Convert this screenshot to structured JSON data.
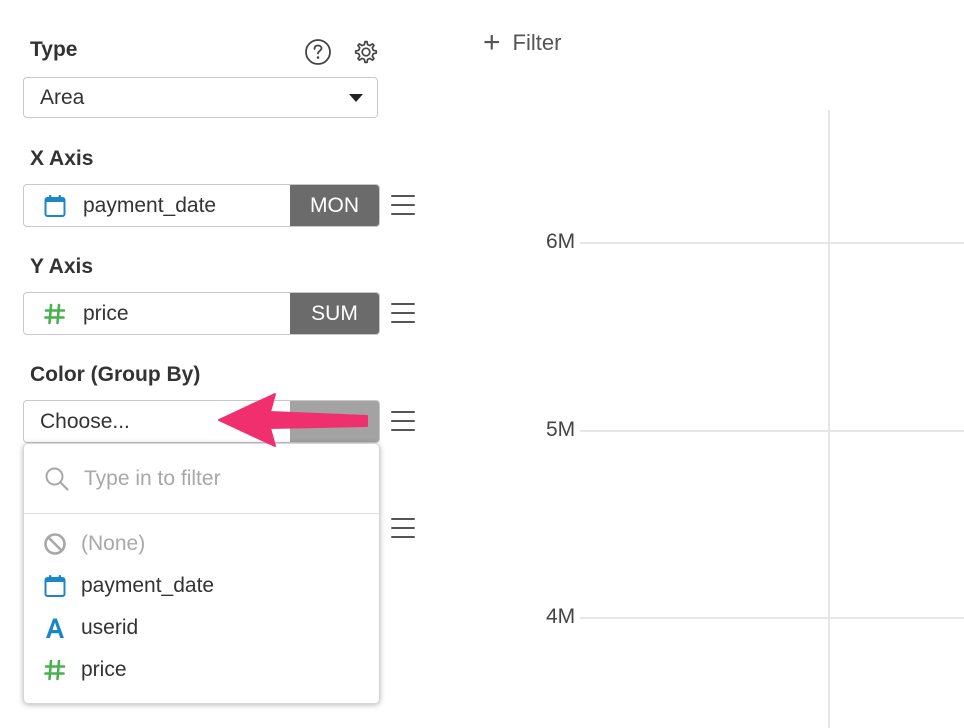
{
  "sidebar": {
    "type": {
      "label": "Type",
      "selected": "Area",
      "help_icon": "question-circle-icon",
      "settings_icon": "gear-icon"
    },
    "x_axis": {
      "label": "X Axis",
      "field": "payment_date",
      "field_icon": "calendar-icon",
      "aggregation": "MON",
      "menu_icon": "hamburger-icon"
    },
    "y_axis": {
      "label": "Y Axis",
      "field": "price",
      "field_icon": "hash-icon",
      "aggregation": "SUM",
      "menu_icon": "hamburger-icon"
    },
    "color_group": {
      "label": "Color (Group By)",
      "placeholder": "Choose...",
      "menu_icon": "hamburger-icon"
    }
  },
  "dropdown": {
    "search_placeholder": "Type in to filter",
    "items": [
      {
        "label": "(None)",
        "icon": "ban-icon"
      },
      {
        "label": "payment_date",
        "icon": "calendar-icon"
      },
      {
        "label": "userid",
        "icon": "text-type-icon"
      },
      {
        "label": "price",
        "icon": "hash-icon"
      }
    ]
  },
  "toolbar": {
    "filter_label": "Filter"
  },
  "chart_data": {
    "type": "area",
    "yticks": [
      "6M",
      "5M",
      "4M"
    ],
    "ylabel": "",
    "xlabel": "",
    "grid": true
  },
  "colors": {
    "calendar": "#1b87c9",
    "hash": "#4caf50",
    "text_type": "#1b87c9",
    "agg_tag": "#6b6b6b",
    "arrow": "#f0306e"
  }
}
